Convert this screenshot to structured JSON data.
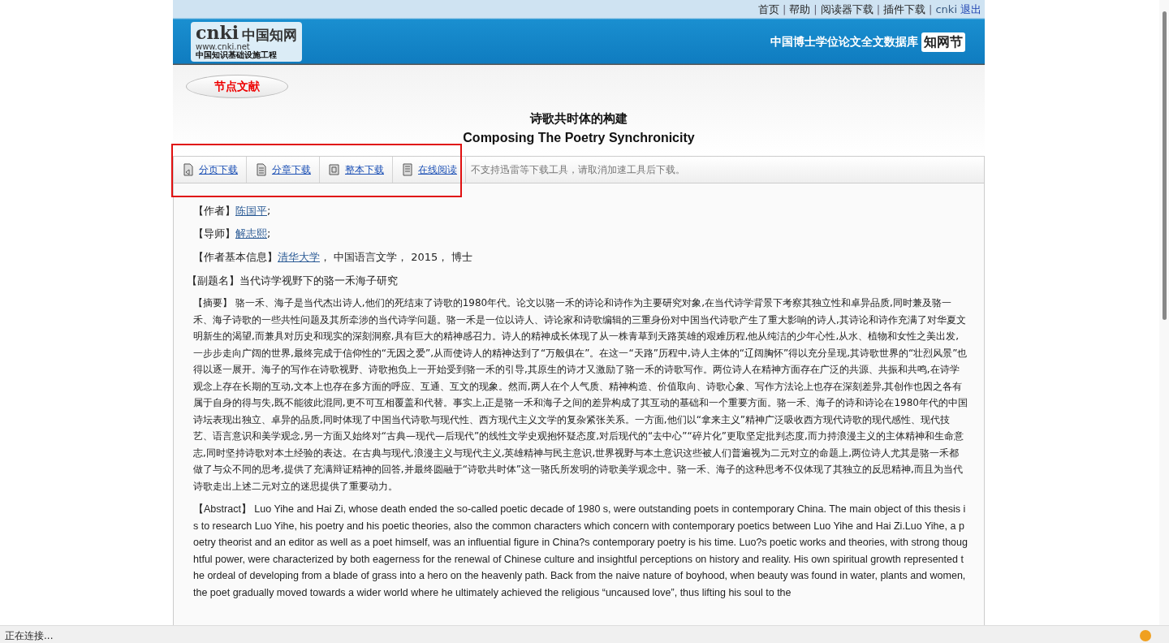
{
  "header": {
    "top_links": [
      "首页",
      "帮助",
      "阅读器下载",
      "插件下载"
    ],
    "link_separator": "|",
    "user": "cnki",
    "logout": "退出",
    "logo": {
      "brand": "cnki",
      "brand_zh": "中国知网",
      "url": "www.cnki.net",
      "tagline": "中国知识基础设施工程"
    },
    "database_title": "中国博士学位论文全文数据库",
    "badge_logo": "知网节"
  },
  "section_tab": "节点文献",
  "title": {
    "zh": "诗歌共时体的构建",
    "en": "Composing The Poetry Synchronicity"
  },
  "toolbar": {
    "buttons": [
      {
        "label": "分页下载",
        "kind": "page"
      },
      {
        "label": "分章下载",
        "kind": "chapter"
      },
      {
        "label": "整本下载",
        "kind": "book"
      },
      {
        "label": "在线阅读",
        "kind": "read"
      }
    ],
    "note": "不支持迅雷等下载工具，请取消加速工具后下载。"
  },
  "fields": [
    {
      "label": "【作者】",
      "parts": [
        {
          "text": "陈国平",
          "kind": "link"
        },
        {
          "text": ";",
          "kind": "plain"
        }
      ]
    },
    {
      "label": "【导师】",
      "parts": [
        {
          "text": "解志熙",
          "kind": "link"
        },
        {
          "text": ";",
          "kind": "plain"
        }
      ]
    },
    {
      "label": "【作者基本信息】",
      "parts": [
        {
          "text": "清华大学",
          "kind": "link"
        },
        {
          "text": "， 中国语言文学， 2015， 博士",
          "kind": "plain"
        }
      ]
    }
  ],
  "subtitle": "【副题名】当代诗学视野下的骆一禾海子研究",
  "abstract_zh": {
    "label": "【摘要】",
    "text": "骆一禾、海子是当代杰出诗人,他们的死结束了诗歌的1980年代。论文以骆一禾的诗论和诗作为主要研究对象,在当代诗学背景下考察其独立性和卓异品质,同时兼及骆一禾、海子诗歌的一些共性问题及其所牵涉的当代诗学问题。骆一禾是一位以诗人、诗论家和诗歌编辑的三重身份对中国当代诗歌产生了重大影响的诗人,其诗论和诗作充满了对华夏文明新生的渴望,而兼具对历史和现实的深刻洞察,具有巨大的精神感召力。诗人的精神成长体现了从一株青草到天路英雄的艰难历程,他从纯洁的少年心性,从水、植物和女性之美出发,一步步走向广阔的世界,最终完成于信仰性的“无因之爱”,从而使诗人的精神达到了“万般俱在”。在这一“天路”历程中,诗人主体的“辽阔胸怀”得以充分呈现,其诗歌世界的“壮烈风景”也得以逐一展开。海子的写作在诗歌视野、诗歌抱负上一开始受到骆一禾的引导,其原生的诗才又激励了骆一禾的诗歌写作。两位诗人在精神方面存在广泛的共源、共振和共鸣,在诗学观念上存在长期的互动,文本上也存在多方面的呼应、互通、互文的现象。然而,两人在个人气质、精神构造、价值取向、诗歌心象、写作方法论上也存在深刻差异,其创作也因之各有属于自身的得与失,既不能彼此混同,更不可互相覆盖和代替。事实上,正是骆一禾和海子之间的差异构成了其互动的基础和一个重要方面。骆一禾、海子的诗和诗论在1980年代的中国诗坛表现出独立、卓异的品质,同时体现了中国当代诗歌与现代性、西方现代主义文学的复杂紧张关系。一方面,他们以“拿来主义”精神广泛吸收西方现代诗歌的现代感性、现代技艺、语言意识和美学观念,另一方面又始终对“古典—现代—后现代”的线性文学史观抱怀疑态度,对后现代的“去中心”“碎片化”更取坚定批判态度,而力持浪漫主义的主体精神和生命意志,同时坚持诗歌对本土经验的表达。在古典与现代,浪漫主义与现代主义,英雄精神与民主意识,世界视野与本土意识这些被人们普遍视为二元对立的命题上,两位诗人尤其是骆一禾都做了与众不同的思考,提供了充满辩证精神的回答,并最终圆融于“诗歌共时体”这一骆氏所发明的诗歌美学观念中。骆一禾、海子的这种思考不仅体现了其独立的反思精神,而且为当代诗歌走出上述二元对立的迷思提供了重要动力。"
  },
  "abstract_en": {
    "label": "【Abstract】",
    "text": "Luo Yihe and Hai Zi, whose death ended the so-called poetic decade of 1980 s, were outstanding poets in contemporary China. The main object of this thesis is to research Luo Yihe, his poetry and his poetic theories, also the common characters which concern with contemporary poetics between Luo Yihe and Hai Zi.Luo Yihe, a poetry theorist and an editor as well as a poet himself, was an influential figure in China?s contemporary poetry is his time. Luo?s poetic works and theories, with strong thoughtful power, were characterized by both eagerness for the renewal of Chinese culture and insightful perceptions on history and reality. His own spiritual growth represented the ordeal of developing from a blade of grass into a hero on the heavenly path. Back from the naive nature of boyhood, when beauty was found in water, plants and women, the poet gradually moved towards a wider world where he ultimately achieved the religious “uncaused love”, thus lifting his soul to the"
  },
  "status_bar": "正在连接..."
}
